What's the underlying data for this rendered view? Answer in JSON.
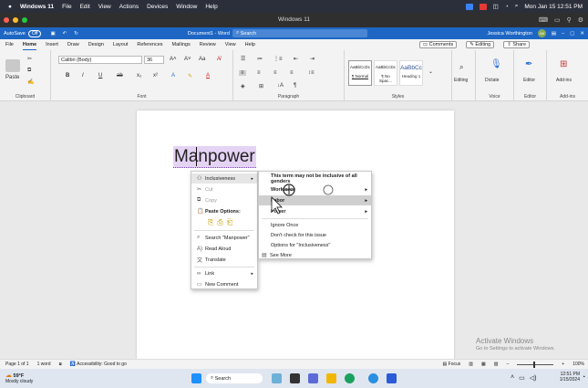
{
  "mac_menubar": {
    "apple": "",
    "app": "Windows 11",
    "items": [
      "File",
      "Edit",
      "View",
      "Actions",
      "Devices",
      "Window",
      "Help"
    ],
    "clock": "Mon Jan 15 12:51 PM"
  },
  "vm_window": {
    "title": "Windows 11"
  },
  "word_titlebar": {
    "autosave": "AutoSave",
    "autosave_state": "Off",
    "doc_title": "Document1 - Word",
    "search_placeholder": "Search",
    "user": "Jessica Worthington",
    "initials": "JW"
  },
  "ribbon_tabs": [
    "File",
    "Home",
    "Insert",
    "Draw",
    "Design",
    "Layout",
    "References",
    "Mailings",
    "Review",
    "View",
    "Help"
  ],
  "ribbon_right": {
    "comments": "Comments",
    "editing": "Editing",
    "share": "Share"
  },
  "ribbon": {
    "clipboard": {
      "paste": "Paste",
      "label": "Clipboard"
    },
    "font": {
      "name": "Calibri (Body)",
      "size": "36",
      "label": "Font",
      "bold": "B",
      "italic": "I",
      "underline": "U",
      "strike": "ab",
      "sub": "x₂",
      "sup": "x²"
    },
    "paragraph": {
      "label": "Paragraph"
    },
    "styles": {
      "label": "Styles",
      "items": [
        {
          "preview": "AaBbCcDc",
          "name": "¶ Normal"
        },
        {
          "preview": "AaBbCcDc",
          "name": "¶ No Spac..."
        },
        {
          "preview": "AaBbCc",
          "name": "Heading 1"
        }
      ]
    },
    "editing": {
      "label": "Editing"
    },
    "voice": {
      "dictate": "Dictate",
      "label": "Voice"
    },
    "editor": {
      "name": "Editor",
      "label": "Editor"
    },
    "addins": {
      "name": "Add-ins",
      "label": "Add-ins"
    }
  },
  "document": {
    "text": "Manpower"
  },
  "context_menu": {
    "items": [
      {
        "icon": "inclusiveness-icon",
        "label": "Inclusiveness",
        "enabled": true,
        "submenu": true
      },
      {
        "icon": "cut-icon",
        "label": "Cut",
        "enabled": false
      },
      {
        "icon": "copy-icon",
        "label": "Copy",
        "enabled": false
      },
      {
        "icon": "paste-icon",
        "label": "Paste Options:",
        "enabled": true
      },
      {
        "icon": "search-icon",
        "label": "Search \"Manpower\"",
        "enabled": true
      },
      {
        "icon": "read-aloud-icon",
        "label": "Read Aloud",
        "enabled": true
      },
      {
        "icon": "translate-icon",
        "label": "Translate",
        "enabled": true
      },
      {
        "icon": "link-icon",
        "label": "Link",
        "enabled": true,
        "submenu": true
      },
      {
        "icon": "comment-icon",
        "label": "New Comment",
        "enabled": true
      }
    ]
  },
  "submenu": {
    "header": "This term may not be inclusive of all genders",
    "items": [
      {
        "label": "Workforce",
        "submenu": true
      },
      {
        "label": "Labor",
        "submenu": true
      },
      {
        "label": "Power",
        "submenu": true
      },
      {
        "label": "Ignore Once"
      },
      {
        "label": "Don't check for this issue"
      },
      {
        "label": "Options for \"Inclusiveness\""
      },
      {
        "label": "See More"
      }
    ]
  },
  "watermark": {
    "title": "Activate Windows",
    "subtitle": "Go to Settings to activate Windows."
  },
  "statusbar": {
    "page": "Page 1 of 1",
    "words": "1 word",
    "accessibility": "Accessibility: Good to go",
    "focus": "Focus",
    "zoom": "100%"
  },
  "taskbar": {
    "weather_temp": "59°F",
    "weather_desc": "Mostly cloudy",
    "search": "Search",
    "time": "12:51 PM",
    "date": "1/15/2024"
  }
}
